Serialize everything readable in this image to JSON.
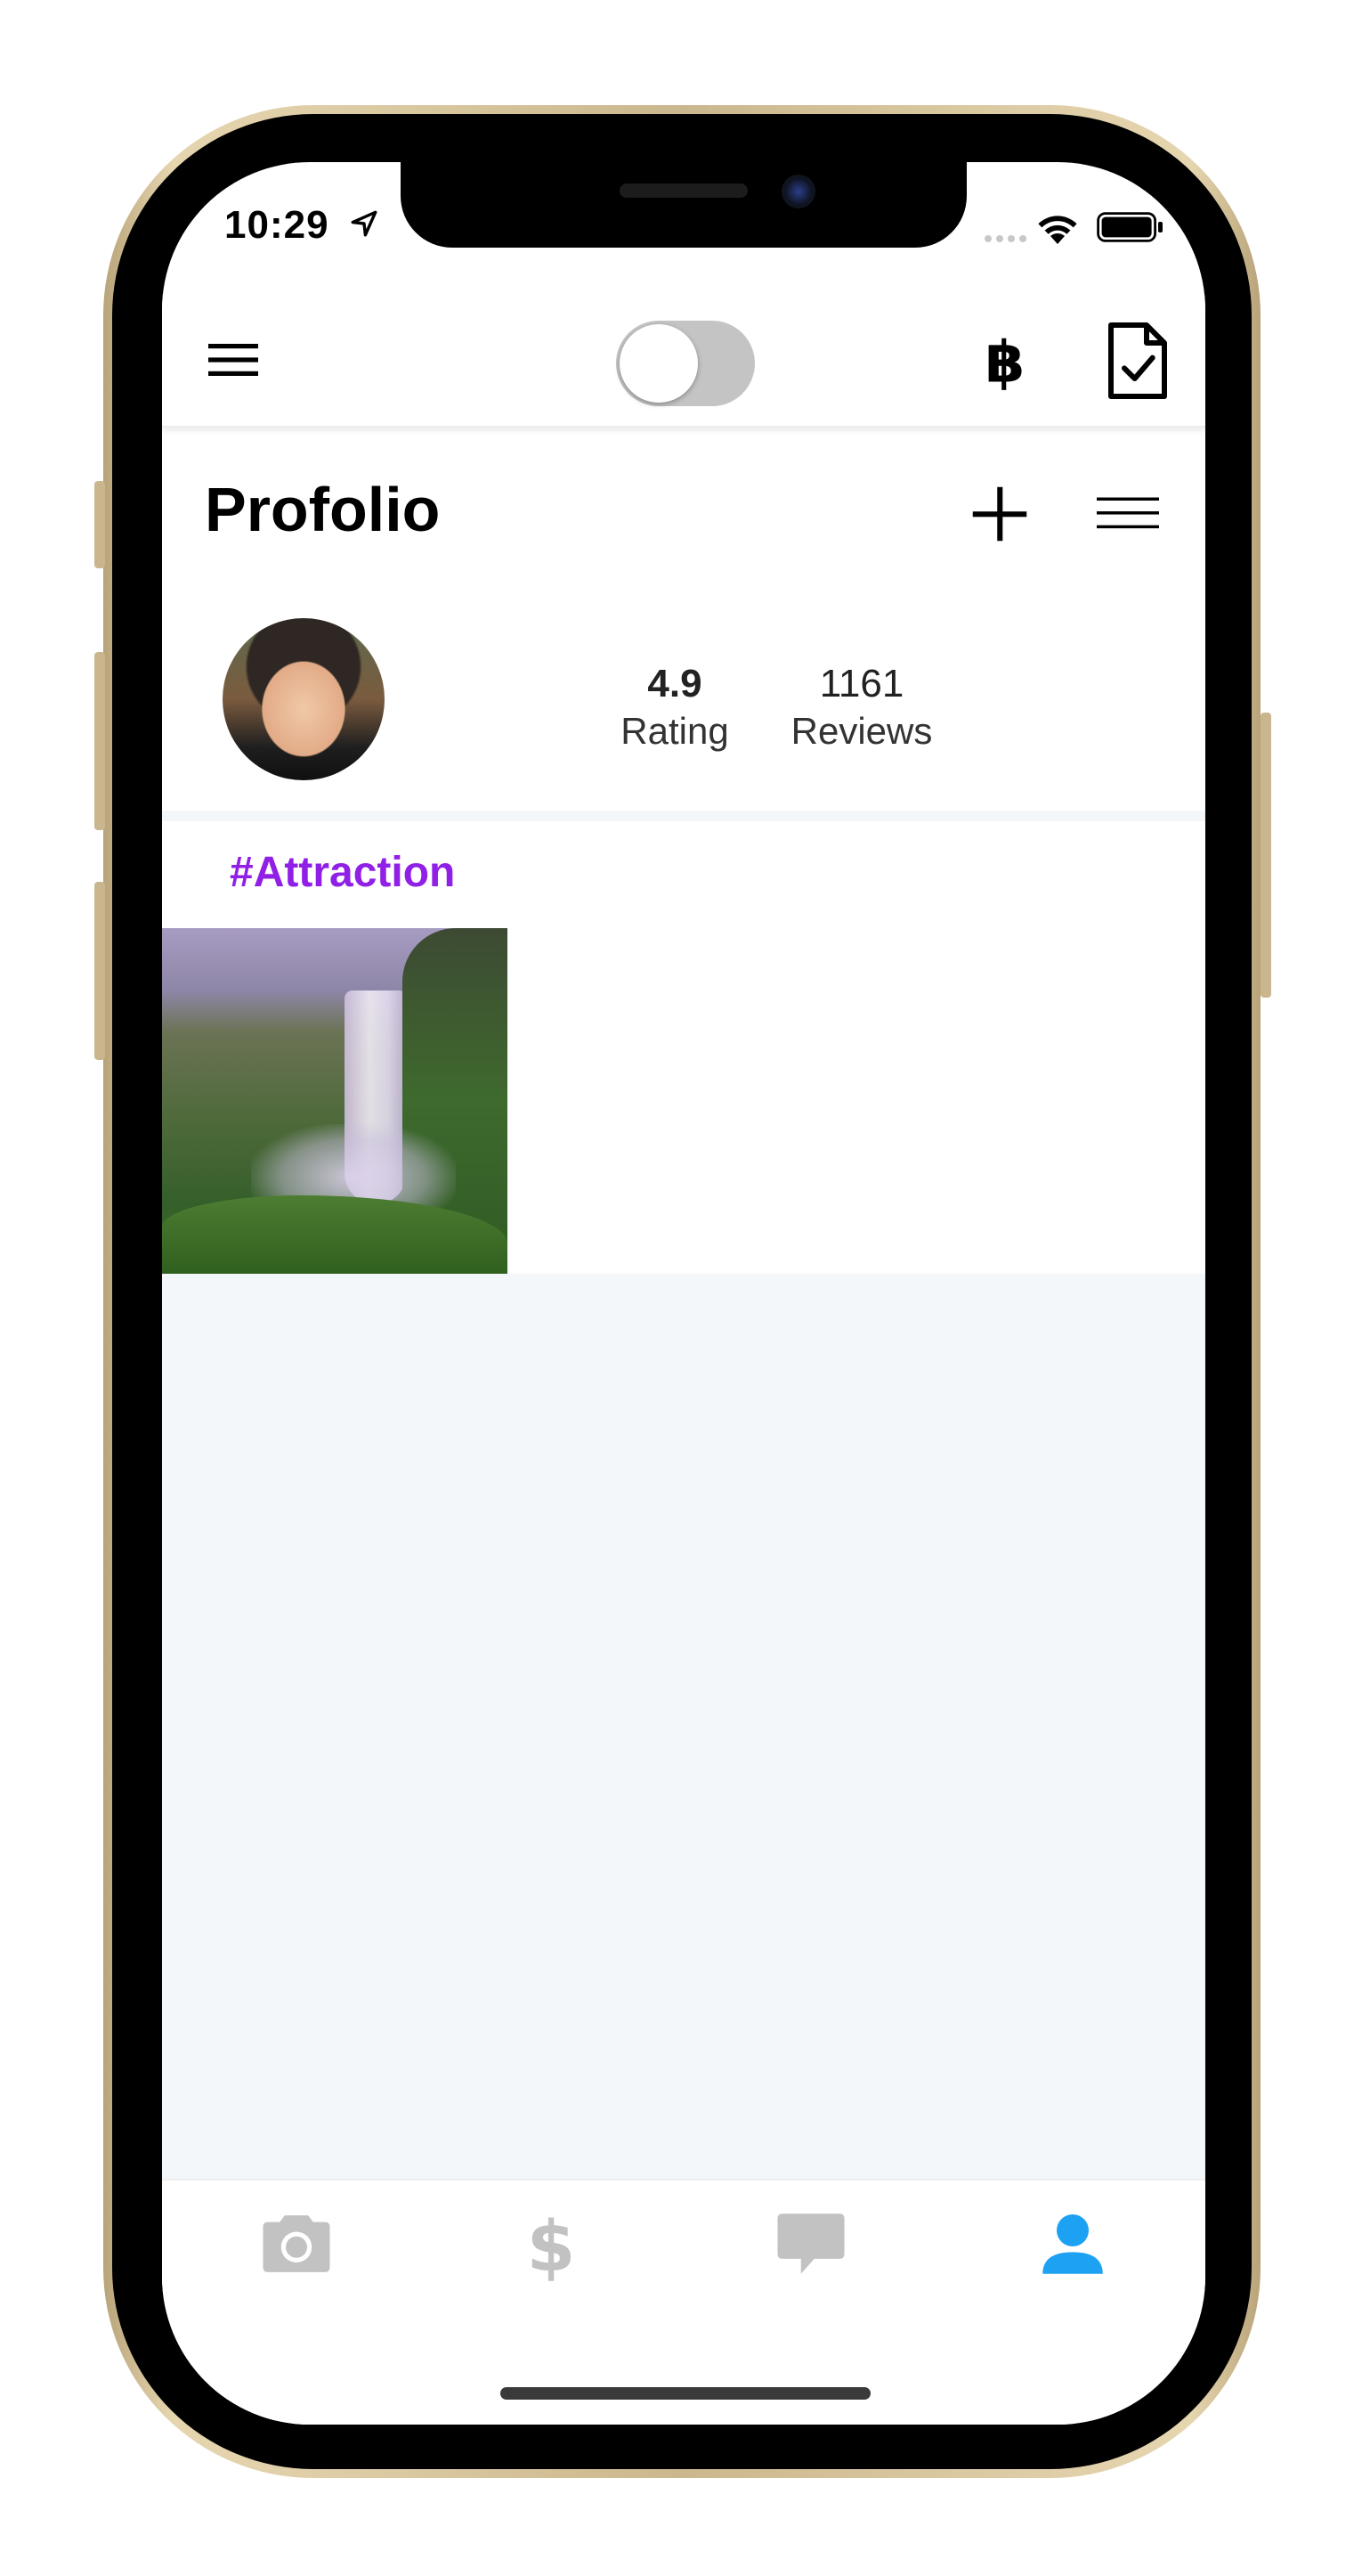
{
  "status_bar": {
    "time": "10:29",
    "icons": [
      "location-arrow-icon",
      "signal-icon",
      "wifi-icon",
      "battery-icon"
    ]
  },
  "toolbar": {
    "menu_icon": "hamburger-icon",
    "toggle_state": "off",
    "bitcoin_icon": "bitcoin-icon",
    "document_icon": "document-check-icon"
  },
  "profile": {
    "title": "Profolio",
    "add_icon": "plus-icon",
    "menu_icon": "menu-lines-icon",
    "rating_value": "4.9",
    "rating_label": "Rating",
    "reviews_value": "1161",
    "reviews_label": "Reviews"
  },
  "portfolio": {
    "tag": "#Attraction",
    "photos": [
      {
        "subject": "waterfall"
      }
    ]
  },
  "tabbar": {
    "tabs": [
      {
        "icon": "camera-icon",
        "active": false
      },
      {
        "icon": "dollar-icon",
        "active": false
      },
      {
        "icon": "chat-bubble-icon",
        "active": false
      },
      {
        "icon": "person-icon",
        "active": true
      }
    ],
    "active_color": "#1da1f2",
    "inactive_color": "#c2c2c2"
  },
  "colors": {
    "tag": "#9120e6",
    "background_grey": "#f4f7fa"
  }
}
